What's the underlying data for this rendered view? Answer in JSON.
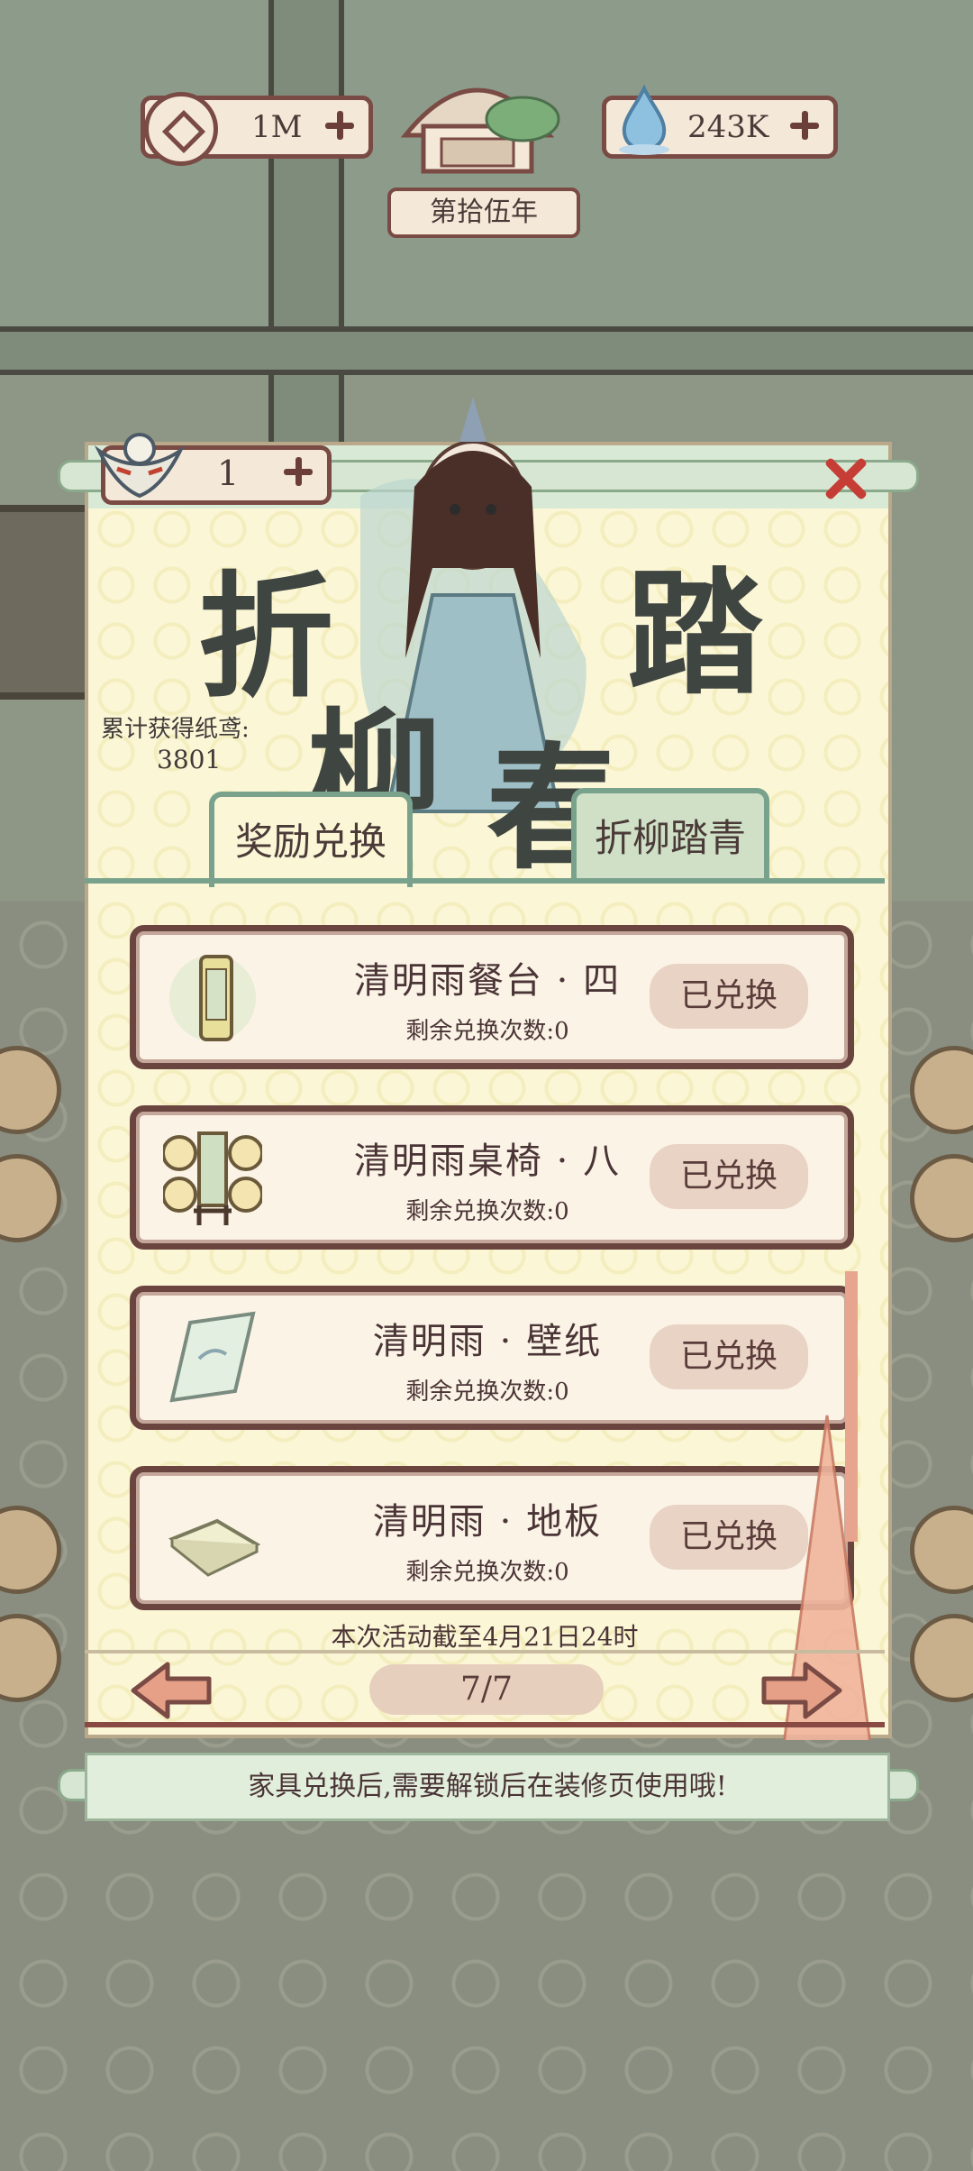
{
  "top_bar": {
    "coins": "1M",
    "jade": "243K",
    "year_label": "第拾伍年"
  },
  "panel": {
    "kite_count": "1",
    "banner": {
      "c1": "折",
      "c2": "柳",
      "c3": "踏",
      "c4": "春"
    },
    "stats": {
      "label": "累计获得纸鸢:",
      "value": "3801"
    },
    "tabs": [
      {
        "label": "奖励兑换"
      },
      {
        "label": "折柳踏青"
      }
    ],
    "items": [
      {
        "name": "清明雨餐台 · 四",
        "remain": "剩余兑换次数:0",
        "status": "已兑换"
      },
      {
        "name": "清明雨桌椅 · 八",
        "remain": "剩余兑换次数:0",
        "status": "已兑换"
      },
      {
        "name": "清明雨 · 壁纸",
        "remain": "剩余兑换次数:0",
        "status": "已兑换"
      },
      {
        "name": "清明雨 · 地板",
        "remain": "剩余兑换次数:0",
        "status": "已兑换"
      }
    ],
    "deadline": "本次活动截至4月21日24时",
    "page": "7/7",
    "notice": "家具兑换后,需要解锁后在装修页使用哦!"
  },
  "colors": {
    "frame": "#6a4540",
    "close_x": "#c63d36",
    "tab_border": "#79a28c",
    "badge": "#e8d3c4",
    "panel_bg": "#fbf6d6"
  },
  "icons": [
    "coin-icon",
    "jade-drop-icon",
    "kite-icon",
    "close-icon",
    "prev-arrow-icon",
    "next-arrow-icon",
    "plus-icon"
  ]
}
